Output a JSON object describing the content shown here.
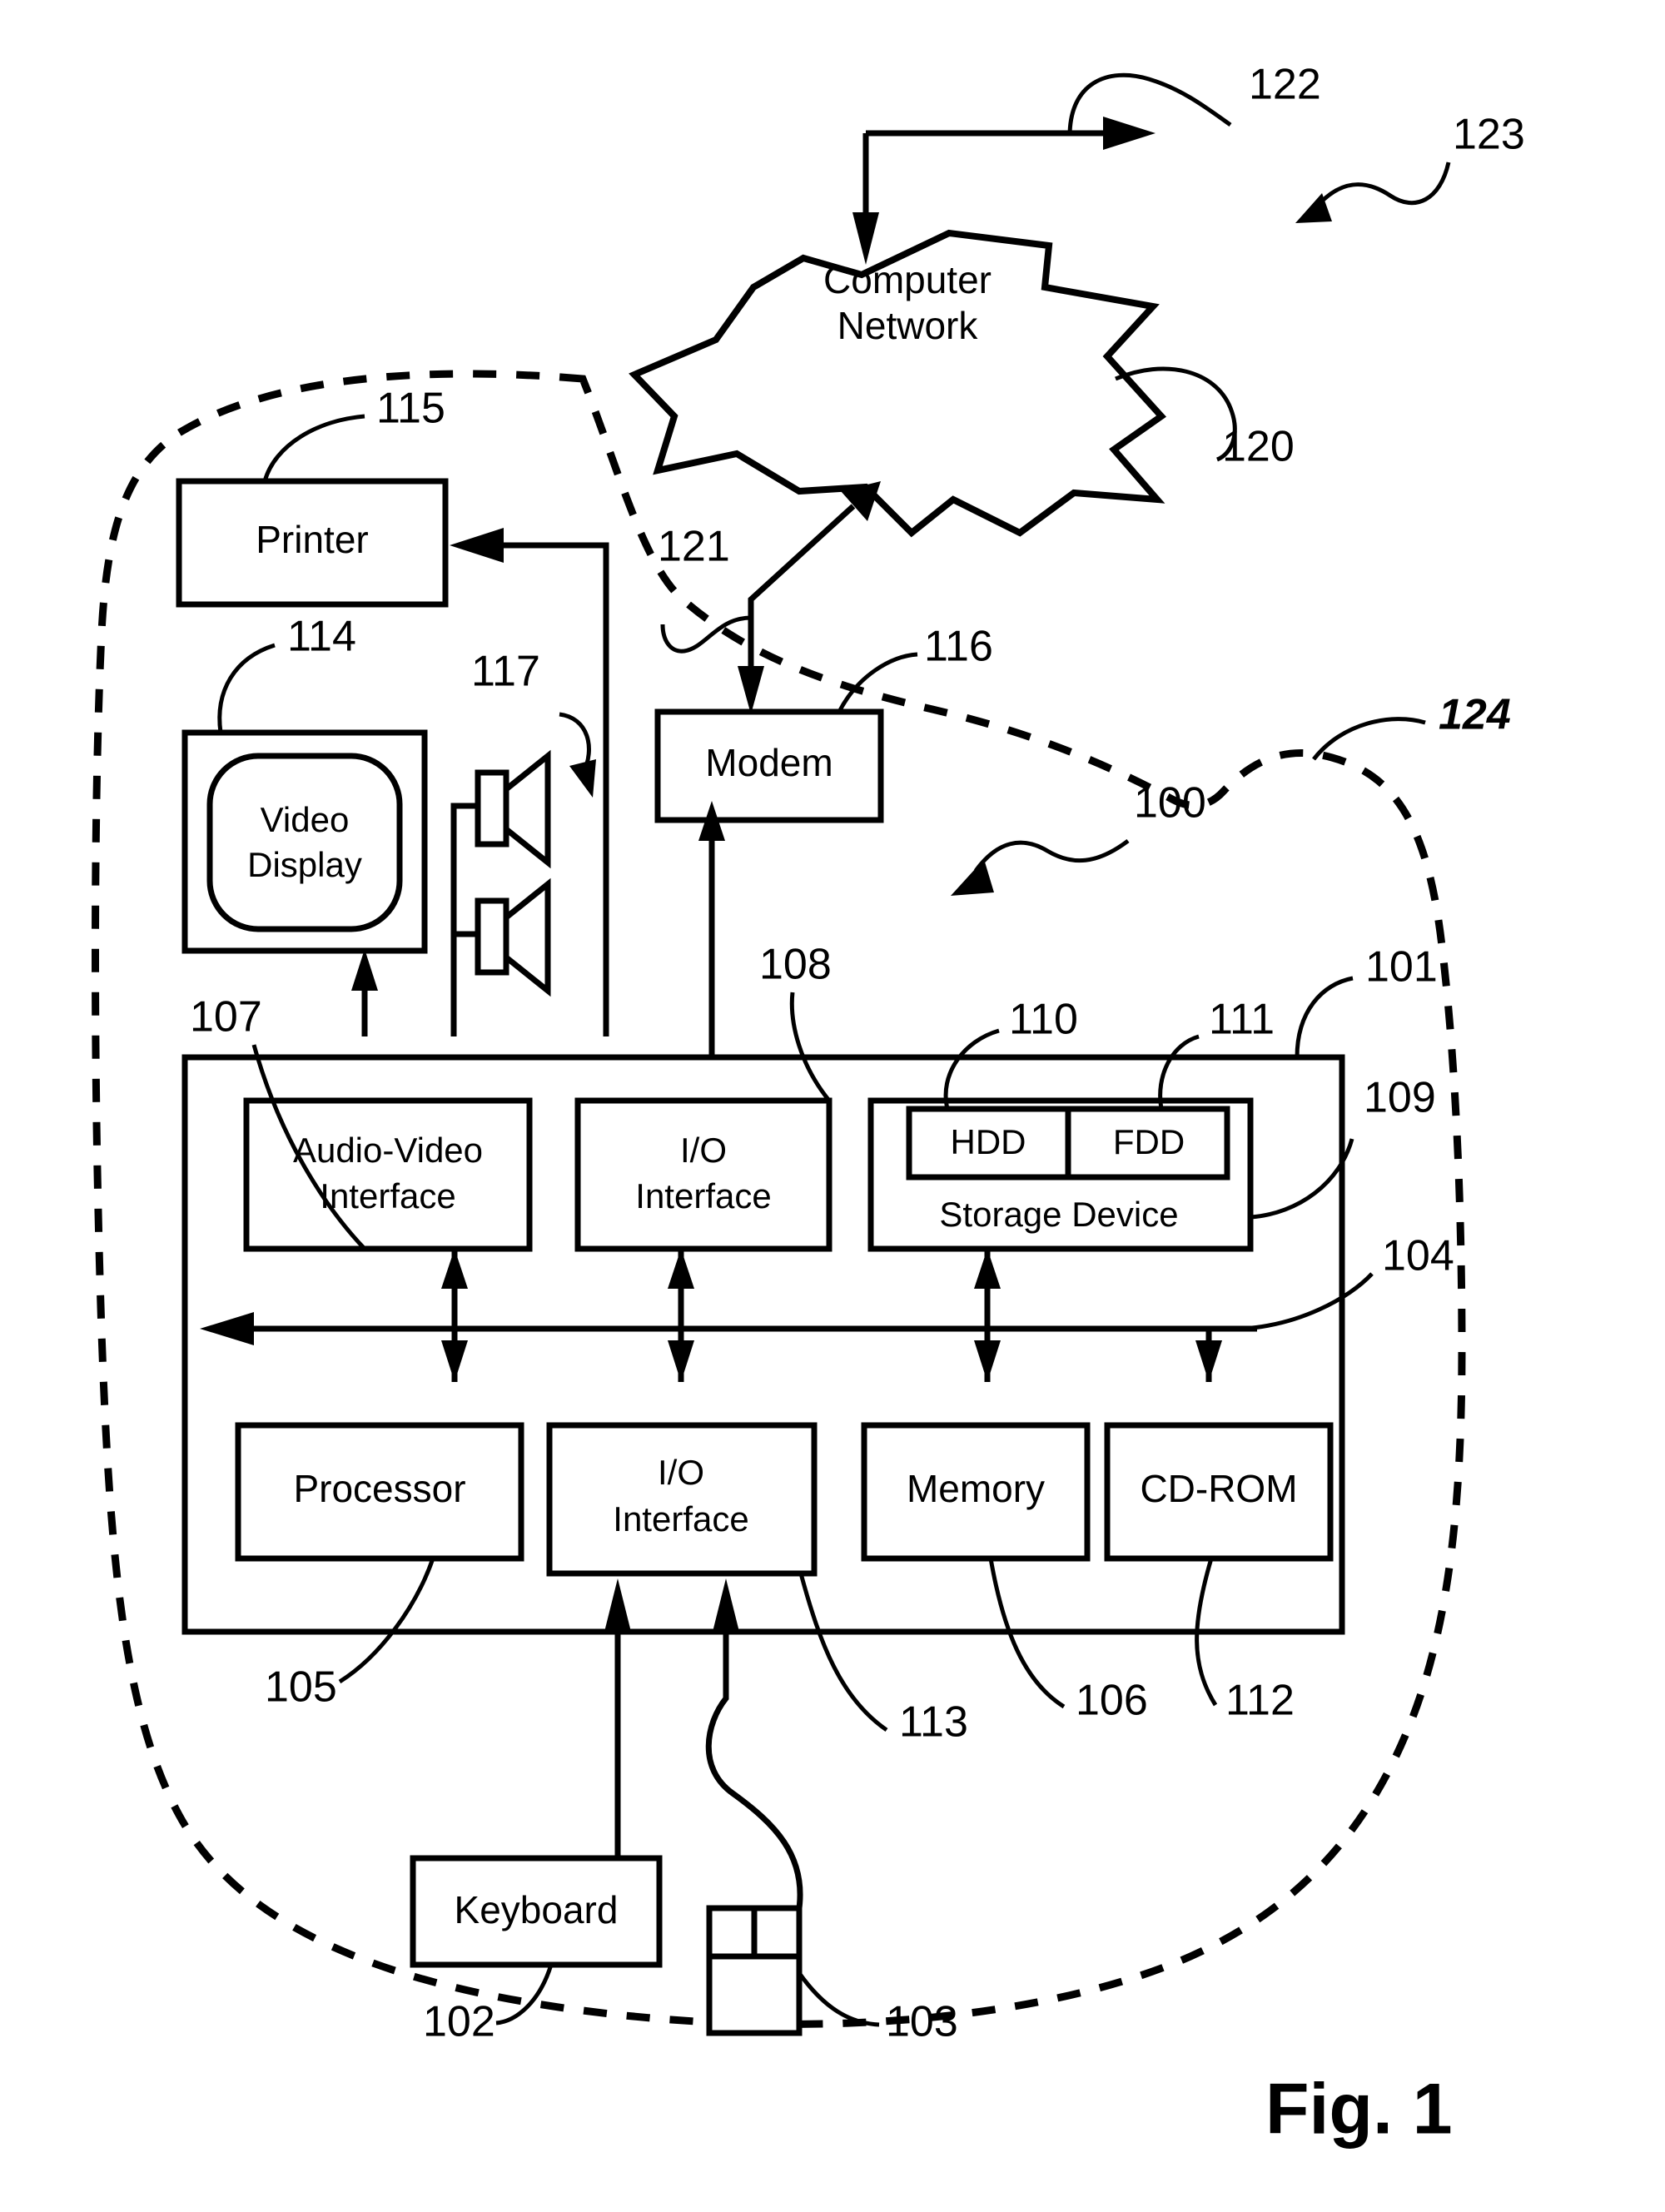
{
  "figure": {
    "caption": "Fig. 1",
    "cloud_label_line1": "Computer",
    "cloud_label_line2": "Network"
  },
  "boxes": {
    "printer": "Printer",
    "video_display_line1": "Video",
    "video_display_line2": "Display",
    "modem": "Modem",
    "audio_video_interface_line1": "Audio-Video",
    "audio_video_interface_line2": "Interface",
    "io_interface_top_line1": "I/O",
    "io_interface_top_line2": "Interface",
    "hdd": "HDD",
    "fdd": "FDD",
    "storage_device": "Storage Device",
    "processor": "Processor",
    "io_interface_bottom_line1": "I/O",
    "io_interface_bottom_line2": "Interface",
    "memory": "Memory",
    "cdrom": "CD-ROM",
    "keyboard": "Keyboard"
  },
  "reference_numerals": {
    "n100": "100",
    "n101": "101",
    "n102": "102",
    "n103": "103",
    "n104": "104",
    "n105": "105",
    "n106": "106",
    "n107": "107",
    "n108": "108",
    "n109": "109",
    "n110": "110",
    "n111": "111",
    "n112": "112",
    "n113": "113",
    "n114": "114",
    "n115": "115",
    "n116": "116",
    "n117": "117",
    "n120": "120",
    "n121": "121",
    "n122": "122",
    "n123": "123",
    "n124": "124"
  },
  "colors": {
    "ink": "#000000",
    "paper": "#ffffff"
  }
}
